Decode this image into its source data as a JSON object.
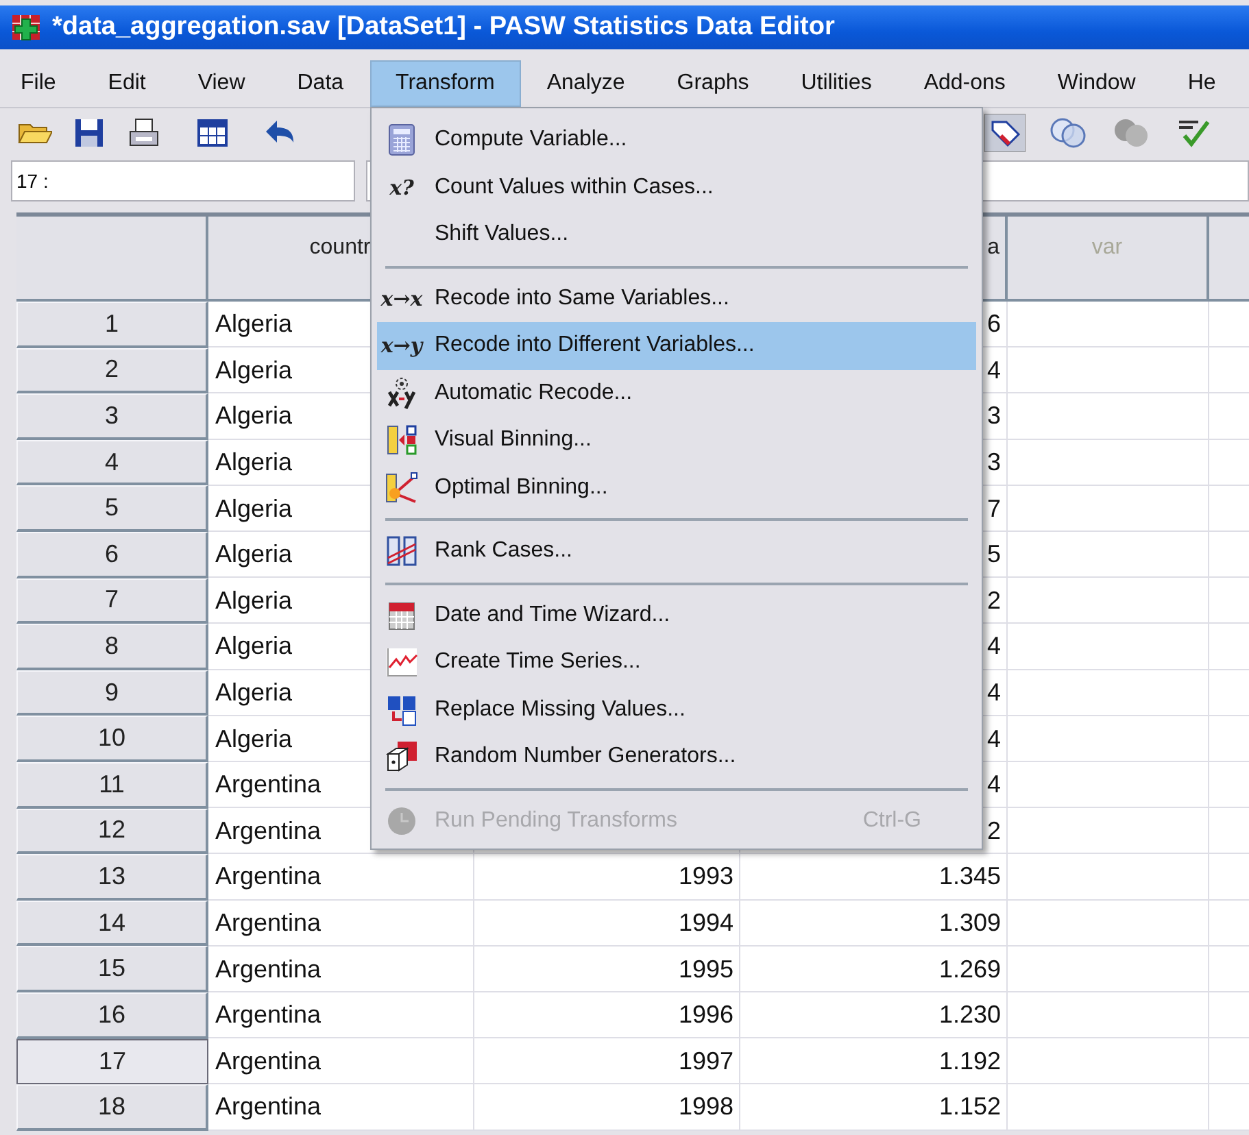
{
  "window": {
    "title": "*data_aggregation.sav [DataSet1] - PASW Statistics Data Editor"
  },
  "menu_bar": [
    {
      "label": "File",
      "selected": false
    },
    {
      "label": "Edit",
      "selected": false
    },
    {
      "label": "View",
      "selected": false
    },
    {
      "label": "Data",
      "selected": false
    },
    {
      "label": "Transform",
      "selected": true
    },
    {
      "label": "Analyze",
      "selected": false
    },
    {
      "label": "Graphs",
      "selected": false
    },
    {
      "label": "Utilities",
      "selected": false
    },
    {
      "label": "Add-ons",
      "selected": false
    },
    {
      "label": "Window",
      "selected": false
    },
    {
      "label": "He",
      "selected": false
    }
  ],
  "cell_editor": {
    "cell_ref": "17 :"
  },
  "grid": {
    "columns": [
      {
        "label": "countr",
        "kind": "string"
      },
      {
        "kind": "numeric"
      },
      {
        "label": "a",
        "kind": "numeric"
      },
      {
        "label": "var",
        "kind": "empty"
      },
      {
        "kind": "empty"
      }
    ],
    "rows": [
      {
        "case": "1",
        "country": "Algeria",
        "value": "6",
        "selected": false
      },
      {
        "case": "2",
        "country": "Algeria",
        "value": "4",
        "selected": false
      },
      {
        "case": "3",
        "country": "Algeria",
        "value": "3",
        "selected": false
      },
      {
        "case": "4",
        "country": "Algeria",
        "value": "3",
        "selected": false
      },
      {
        "case": "5",
        "country": "Algeria",
        "value": "7",
        "selected": false
      },
      {
        "case": "6",
        "country": "Algeria",
        "value": "5",
        "selected": false
      },
      {
        "case": "7",
        "country": "Algeria",
        "value": "2",
        "selected": false
      },
      {
        "case": "8",
        "country": "Algeria",
        "value": "4",
        "selected": false
      },
      {
        "case": "9",
        "country": "Algeria",
        "value": "4",
        "selected": false
      },
      {
        "case": "10",
        "country": "Algeria",
        "value": "4",
        "selected": false
      },
      {
        "case": "11",
        "country": "Argentina",
        "value": "4",
        "selected": false
      },
      {
        "case": "12",
        "country": "Argentina",
        "value": "2",
        "selected": false
      },
      {
        "case": "13",
        "country": "Argentina",
        "year": "1993",
        "value": "1.345",
        "selected": false
      },
      {
        "case": "14",
        "country": "Argentina",
        "year": "1994",
        "value": "1.309",
        "selected": false
      },
      {
        "case": "15",
        "country": "Argentina",
        "year": "1995",
        "value": "1.269",
        "selected": false
      },
      {
        "case": "16",
        "country": "Argentina",
        "year": "1996",
        "value": "1.230",
        "selected": false
      },
      {
        "case": "17",
        "country": "Argentina",
        "year": "1997",
        "value": "1.192",
        "selected": true
      },
      {
        "case": "18",
        "country": "Argentina",
        "year": "1998",
        "value": "1.152",
        "selected": false
      }
    ]
  },
  "transform_menu": [
    {
      "kind": "item",
      "label": "Compute Variable...",
      "selected": false,
      "disabled": false
    },
    {
      "kind": "item",
      "glyph": "x?",
      "label": "Count Values within Cases...",
      "selected": false,
      "disabled": false
    },
    {
      "kind": "item",
      "label": "Shift Values...",
      "selected": false,
      "disabled": false
    },
    {
      "kind": "separator"
    },
    {
      "kind": "item",
      "glyph": "x→x",
      "label": "Recode into Same Variables...",
      "selected": false,
      "disabled": false
    },
    {
      "kind": "item",
      "glyph": "x→y",
      "label": "Recode into Different Variables...",
      "selected": true,
      "disabled": false
    },
    {
      "kind": "item",
      "label": "Automatic Recode...",
      "selected": false,
      "disabled": false
    },
    {
      "kind": "item",
      "label": "Visual Binning...",
      "selected": false,
      "disabled": false
    },
    {
      "kind": "item",
      "label": "Optimal Binning...",
      "selected": false,
      "disabled": false
    },
    {
      "kind": "separator"
    },
    {
      "kind": "item",
      "label": "Rank Cases...",
      "selected": false,
      "disabled": false
    },
    {
      "kind": "separator"
    },
    {
      "kind": "item",
      "label": "Date and Time Wizard...",
      "selected": false,
      "disabled": false
    },
    {
      "kind": "item",
      "label": "Create Time Series...",
      "selected": false,
      "disabled": false
    },
    {
      "kind": "item",
      "label": "Replace Missing Values...",
      "selected": false,
      "disabled": false
    },
    {
      "kind": "item",
      "label": "Random Number Generators...",
      "selected": false,
      "disabled": false
    },
    {
      "kind": "separator"
    },
    {
      "kind": "item",
      "label": "Run Pending Transforms",
      "shortcut": "Ctrl-G",
      "selected": false,
      "disabled": true
    }
  ]
}
